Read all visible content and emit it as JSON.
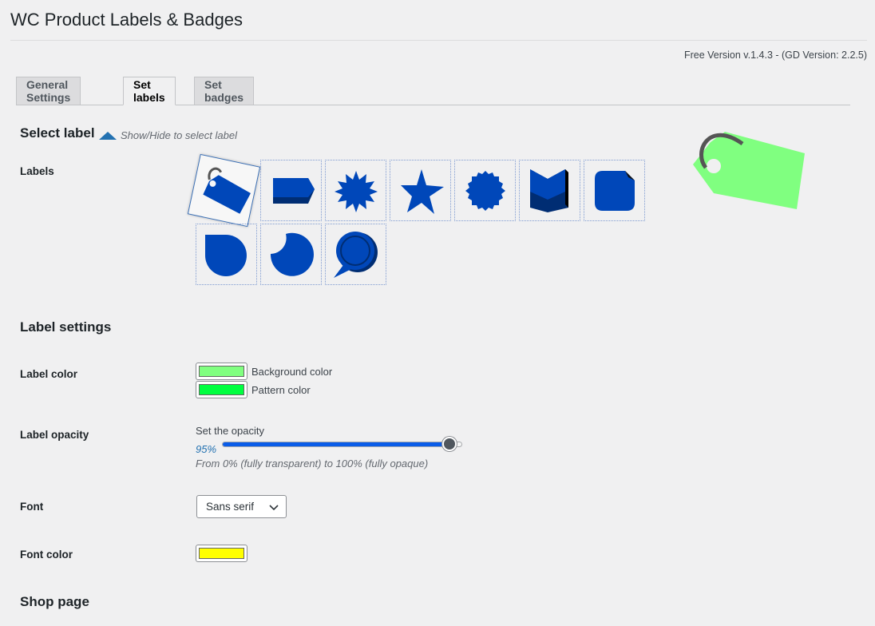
{
  "page": {
    "title": "WC Product Labels & Badges",
    "version": "Free Version v.1.4.3 - (GD Version: 2.2.5)"
  },
  "tabs": [
    {
      "label": "General Settings",
      "active": false
    },
    {
      "label": "Set labels",
      "active": true
    },
    {
      "label": "Set badges",
      "active": false
    }
  ],
  "select_label": {
    "heading": "Select label",
    "toggle_text": "Show/Hide to select label",
    "row_label": "Labels",
    "shapes": [
      "tag-icon",
      "ribbon-icon",
      "starburst-icon",
      "star-icon",
      "seal-icon",
      "bookmark-icon",
      "rounded-square-icon",
      "circle-corner-icon",
      "moon-icon",
      "speech-bubble-icon"
    ],
    "selected_shape": "tag-icon",
    "shape_color": "#0047b9"
  },
  "preview": {
    "icon": "tag-icon",
    "color": "#80ff80"
  },
  "label_settings": {
    "heading": "Label settings",
    "color_label": "Label color",
    "background_color_text": "Background color",
    "background_color": "#80ff80",
    "pattern_color_text": "Pattern color",
    "pattern_color": "#00ff40",
    "opacity_label": "Label opacity",
    "opacity_caption": "Set the opacity",
    "opacity_value": "95%",
    "opacity_fraction": 0.95,
    "opacity_help": "From 0% (fully transparent) to 100% (fully opaque)",
    "font_label": "Font",
    "font_value": "Sans serif",
    "font_color_label": "Font color",
    "font_color": "#ffff00"
  },
  "shop_page": {
    "heading": "Shop page"
  }
}
